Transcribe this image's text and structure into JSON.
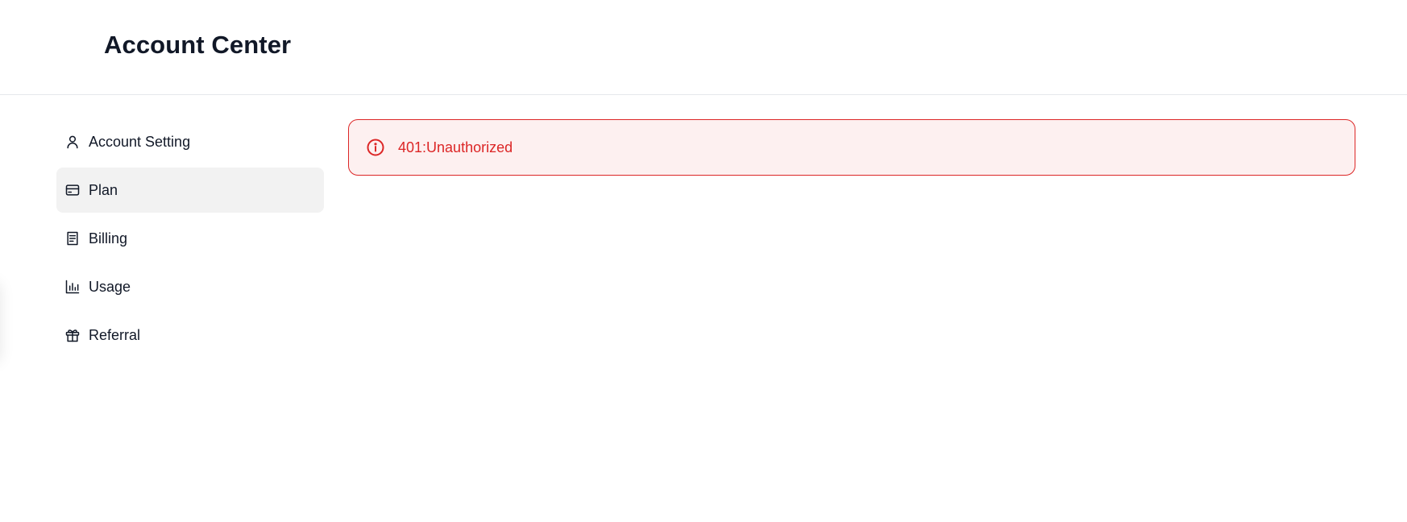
{
  "header": {
    "title": "Account Center"
  },
  "sidebar": {
    "items": [
      {
        "label": "Account Setting",
        "icon": "user-icon",
        "active": false
      },
      {
        "label": "Plan",
        "icon": "credit-card-icon",
        "active": true
      },
      {
        "label": "Billing",
        "icon": "receipt-icon",
        "active": false
      },
      {
        "label": "Usage",
        "icon": "bar-chart-icon",
        "active": false
      },
      {
        "label": "Referral",
        "icon": "gift-icon",
        "active": false
      }
    ]
  },
  "alert": {
    "message": "401:Unauthorized",
    "icon": "info-circle-icon",
    "color": "#dc2626",
    "background": "#fdf0f0"
  },
  "colors": {
    "active_item_bg": "#f2f2f2",
    "text": "#111827",
    "divider": "#e5e7eb"
  }
}
